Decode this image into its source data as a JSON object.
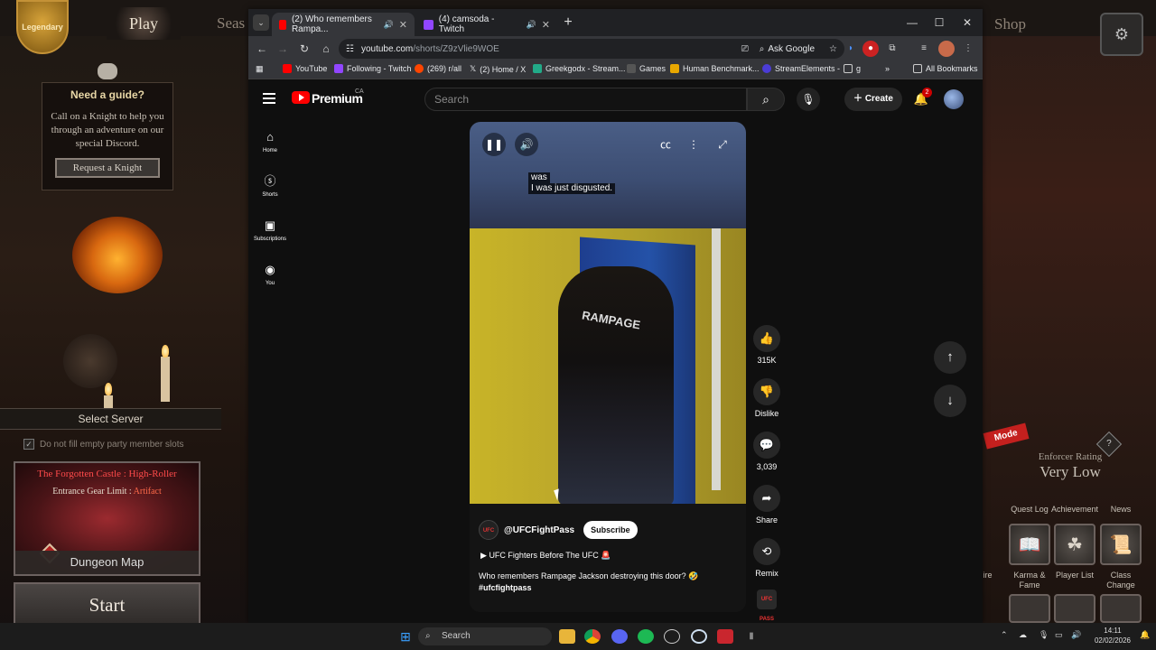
{
  "game": {
    "badge": "Legendary",
    "play": "Play",
    "seasons_partial": "Seas",
    "shop": "Shop",
    "guide_title": "Need a guide?",
    "guide_text": "Call on a Knight to help you through an adventure on our special Discord.",
    "request_knight": "Request a Knight",
    "select_server": "Select Server",
    "fill_slots": "Do not fill empty party member slots",
    "dungeon_name": "The Forgotten Castle : High-Roller",
    "gear_limit_label": "Entrance Gear Limit :",
    "gear_limit_value": "Artifact",
    "dungeon_map": "Dungeon Map",
    "start": "Start",
    "mode_tag": "Mode",
    "enforcer_label": "Enforcer Rating",
    "enforcer_value": "Very Low",
    "tabs": [
      "Quest Log",
      "Achievement",
      "News"
    ],
    "menu_labels": [
      "uire",
      "Karma & Fame",
      "Player List",
      "Class Change"
    ]
  },
  "browser": {
    "tabs": [
      {
        "title": "(2) Who remembers Rampa...",
        "active": true
      },
      {
        "title": "(4) camsoda - Twitch",
        "active": false
      }
    ],
    "url_host": "youtube.com",
    "url_path": "/shorts/Z9zVlie9WOE",
    "ask_google": "Ask Google",
    "bookmarks": [
      "YouTube",
      "Following - Twitch",
      "(269) r/all",
      "(2) Home / X",
      "Greekgodx - Stream...",
      "Games",
      "Human Benchmark...",
      "StreamElements -",
      "g"
    ],
    "all_bookmarks": "All Bookmarks"
  },
  "youtube": {
    "brand": "Premium",
    "region": "CA",
    "search_placeholder": "Search",
    "create": "Create",
    "notifications": "2",
    "sidebar": [
      "Home",
      "Shorts",
      "Subscriptions",
      "You"
    ],
    "captions": [
      "was",
      "I was just disgusted."
    ],
    "overlay_text": "RAMPAGE",
    "channel": "@UFCFightPass",
    "subscribe": "Subscribe",
    "playlist": "UFC Fighters Before The UFC",
    "description": "Who remembers Rampage Jackson destroying this door?",
    "hashtag": "#ufcfightpass",
    "likes": "315K",
    "dislike": "Dislike",
    "comments": "3,039",
    "share": "Share",
    "remix": "Remix",
    "logo_text": "UFC PASS"
  },
  "taskbar": {
    "search": "Search",
    "time": "14:11",
    "date": "02/02/2026"
  }
}
